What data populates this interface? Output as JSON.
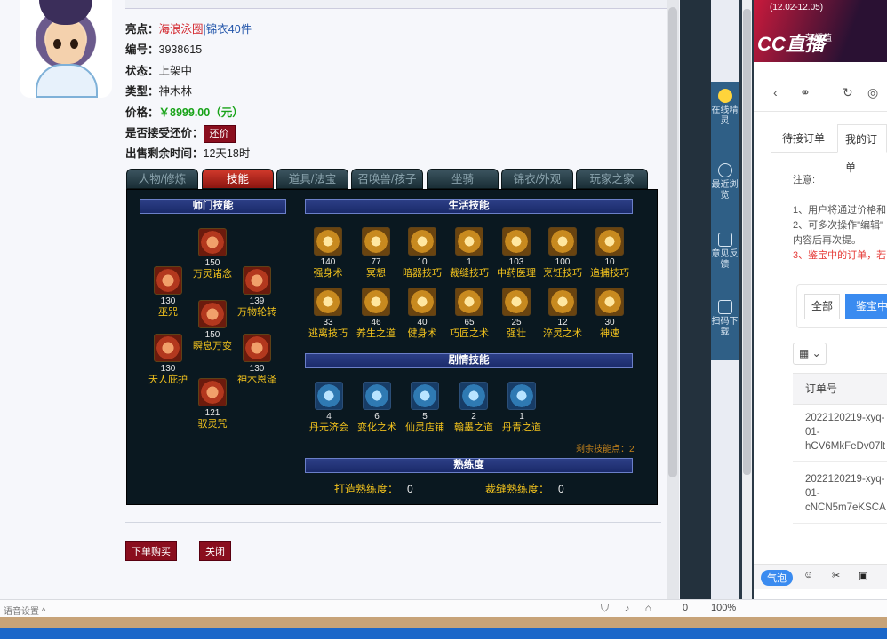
{
  "item": {
    "highlight_label": "亮点：",
    "highlight_a": "海浪泳圈",
    "highlight_sep": "|",
    "highlight_b": "锦衣40件",
    "id_label": "编号：",
    "id_value": "3938615",
    "status_label": "状态：",
    "status_value": "上架中",
    "type_label": "类型：",
    "type_value": "神木林",
    "price_label": "价格：",
    "price_value": "￥8999.00（元）",
    "bargain_label": "是否接受还价：",
    "bargain_button": "还价",
    "remaining_label": "出售剩余时间：",
    "remaining_value": "12天18时"
  },
  "tabs": [
    "人物/修炼",
    "技能",
    "道具/法宝",
    "召唤兽/孩子",
    "坐骑",
    "锦衣/外观",
    "玩家之家"
  ],
  "sections": {
    "master": "师门技能",
    "life": "生活技能",
    "plot": "剧情技能",
    "proficiency": "熟练度"
  },
  "master_skills": [
    {
      "level": "150",
      "name": "万灵诸念"
    },
    {
      "level": "130",
      "name": "巫咒"
    },
    {
      "level": "139",
      "name": "万物轮转"
    },
    {
      "level": "150",
      "name": "瞬息万变"
    },
    {
      "level": "130",
      "name": "天人庇护"
    },
    {
      "level": "130",
      "name": "神木恩泽"
    },
    {
      "level": "121",
      "name": "驭灵咒"
    }
  ],
  "life_skills": [
    {
      "level": "140",
      "name": "强身术"
    },
    {
      "level": "77",
      "name": "冥想"
    },
    {
      "level": "10",
      "name": "暗器技巧"
    },
    {
      "level": "1",
      "name": "裁缝技巧"
    },
    {
      "level": "103",
      "name": "中药医理"
    },
    {
      "level": "100",
      "name": "烹饪技巧"
    },
    {
      "level": "10",
      "name": "追捕技巧"
    },
    {
      "level": "33",
      "name": "逃离技巧"
    },
    {
      "level": "46",
      "name": "养生之道"
    },
    {
      "level": "40",
      "name": "健身术"
    },
    {
      "level": "65",
      "name": "巧匠之术"
    },
    {
      "level": "25",
      "name": "强壮"
    },
    {
      "level": "12",
      "name": "淬灵之术"
    },
    {
      "level": "30",
      "name": "神速"
    }
  ],
  "plot_skills": [
    {
      "level": "4",
      "name": "丹元济会"
    },
    {
      "level": "6",
      "name": "变化之术"
    },
    {
      "level": "5",
      "name": "仙灵店铺"
    },
    {
      "level": "2",
      "name": "翰墨之道"
    },
    {
      "level": "1",
      "name": "丹青之道"
    }
  ],
  "remaining_points": "剩余技能点：2",
  "proficiency": {
    "forge_label": "打造熟练度：",
    "forge_value": "0",
    "tailor_label": "裁缝熟练度：",
    "tailor_value": "0"
  },
  "footer": {
    "buy": "下单购买",
    "close": "关闭"
  },
  "sidebar": [
    {
      "label": "在线精灵"
    },
    {
      "label": "最近浏览"
    },
    {
      "label": "意见反馈"
    },
    {
      "label": "扫码下载"
    }
  ],
  "right": {
    "ad_date": "(12.02-12.05)",
    "ad_logo": "CC直播",
    "ad_tag": "荣耀值",
    "tab_pending": "待接订单",
    "tab_mine": "我的订单",
    "notes_title": "注意:",
    "note1": "1、用户将通过价格和",
    "note2": "2、可多次操作\"编辑\"",
    "note2b": "内容后再次提。",
    "note3": "3、鉴宝中的订单，若",
    "filter_all": "全部",
    "filter_active": "鉴宝中",
    "col_order": "订单号",
    "order1": [
      "2022120219-xyq-",
      "01-",
      "hCV6MkFeDv07lt"
    ],
    "order2": [
      "2022120219-xyq-",
      "01-",
      "cNCN5m7eKSCA"
    ],
    "bubble": "气泡"
  },
  "status": {
    "left": "语音设置 ^",
    "count": "0",
    "zoom": "100%"
  },
  "colors": {
    "panel_bg": "#0a1820",
    "active_tab": "#c0281c",
    "skill_name": "#f2c21d",
    "price": "#19a319",
    "highlight": "#d2232a",
    "accent_blue": "#3a8bf0"
  }
}
